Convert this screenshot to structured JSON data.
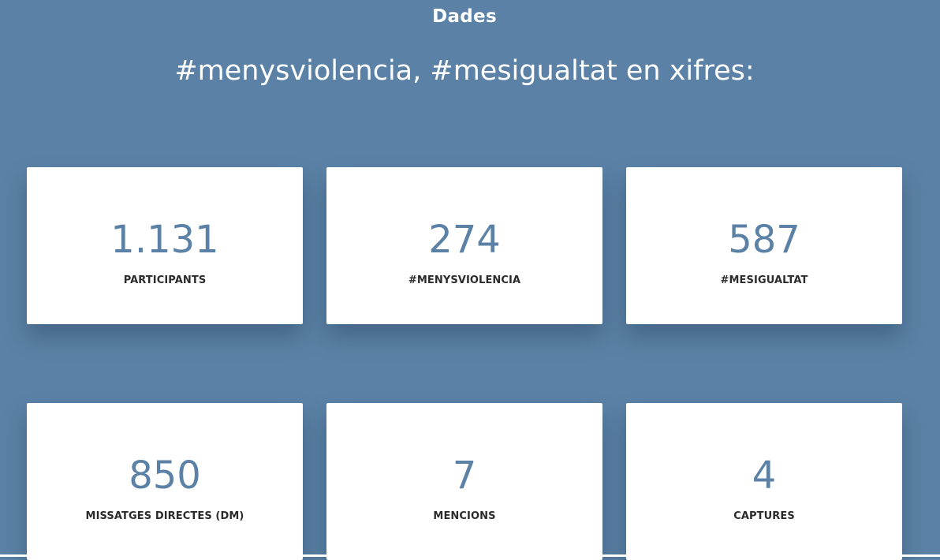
{
  "section": {
    "label": "Dades",
    "headline": "#menysviolencia, #mesigualtat en xifres:"
  },
  "stats": [
    {
      "value": "1.131",
      "label": "PARTICIPANTS"
    },
    {
      "value": "274",
      "label": "#MENYSVIOLENCIA"
    },
    {
      "value": "587",
      "label": "#MESIGUALTAT"
    },
    {
      "value": "850",
      "label": "MISSATGES DIRECTES (DM)"
    },
    {
      "value": "7",
      "label": "MENCIONS"
    },
    {
      "value": "4",
      "label": "CAPTURES"
    }
  ],
  "colors": {
    "background": "#5b82a6",
    "card": "#ffffff",
    "number": "#5b82a6",
    "label": "#2b2b2b"
  }
}
